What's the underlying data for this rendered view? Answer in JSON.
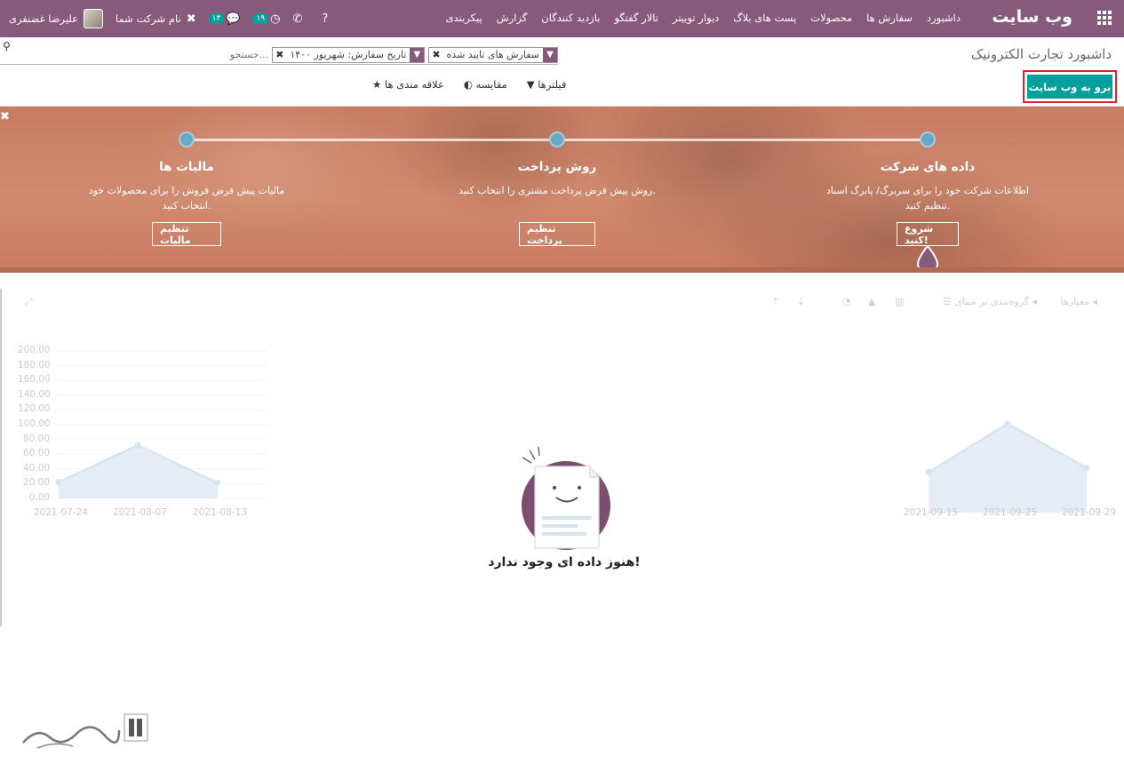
{
  "navbar": {
    "brand": "وب سایت",
    "menu": [
      "داشبورد",
      "سفارش ها",
      "محصولات",
      "پست های بلاگ",
      "دیوار توییتر",
      "تالار گفتگو",
      "بازدید کنندگان",
      "گزارش",
      "پیکربندی"
    ],
    "user_name": "علیرضا غضنفری",
    "company": "نام شرکت شما",
    "activity_badge": "۱۳",
    "clock_badge": "۱۹"
  },
  "control_panel": {
    "title": "داشبورد تجارت الکترونیک",
    "primary_button": "برو به وب سایت",
    "facets": [
      "سفارش های تایید شده",
      "تاریخ سفارش: شهریور ۱۴۰۰"
    ],
    "search_placeholder": "جستجو...",
    "filters": "فیلترها",
    "compare": "مقایسه",
    "favorites": "علاقه مندی ها"
  },
  "onboarding": {
    "steps": [
      {
        "title": "داده های شرکت",
        "desc": "اطلاعات شرکت خود را برای سربرگ/ پابرگ اسناد تنظیم کنید.",
        "button": "شروع کنید!"
      },
      {
        "title": "روش پرداخت",
        "desc": "روش پیش فرض پرداخت مشتری را انتخاب کنید.",
        "button": "تنظیم پرداخت"
      },
      {
        "title": "مالیات ها",
        "desc": "مالیات پیش فرض فروش را برای محصولات خود انتخاب کنید.",
        "button": "تنظیم مالیات"
      }
    ]
  },
  "dashboard": {
    "measures": "معیارها",
    "group_by": "گروه‌بندی بر مبنای",
    "empty_message": "هنوز داده ای وجود ندارد!"
  },
  "chart_data": [
    {
      "type": "area",
      "x": [
        "2021-07-24",
        "2021-08-07",
        "2021-08-13"
      ],
      "values": [
        22,
        72,
        21
      ],
      "yticks": [
        "200.00",
        "180.00",
        "160.00",
        "140.00",
        "120.00",
        "100.00",
        "80.00",
        "60.00",
        "40.00",
        "20.00",
        "0.00"
      ],
      "ylim": [
        0,
        200
      ]
    },
    {
      "type": "area",
      "x": [
        "2021-09-15",
        "2021-09-25",
        "2021-09-29"
      ],
      "values": [
        56,
        123,
        62
      ]
    }
  ]
}
